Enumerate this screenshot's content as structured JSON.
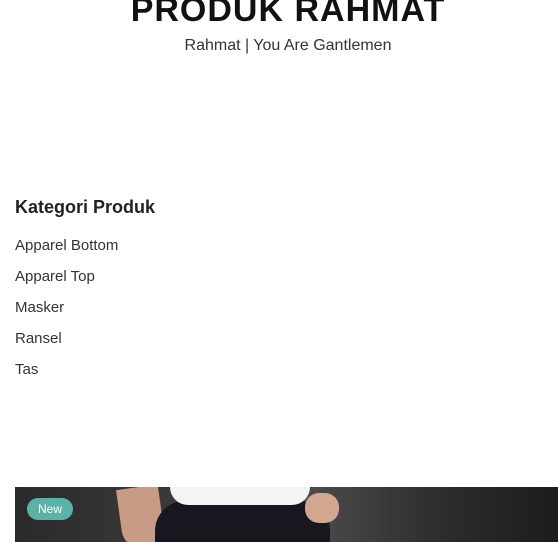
{
  "header": {
    "title": "PRODUK RAHMAT",
    "tagline": "Rahmat | You Are Gantlemen"
  },
  "sidebar": {
    "heading": "Kategori Produk",
    "categories": [
      {
        "label": "Apparel Bottom"
      },
      {
        "label": "Apparel Top"
      },
      {
        "label": "Masker"
      },
      {
        "label": "Ransel"
      },
      {
        "label": "Tas"
      }
    ]
  },
  "product": {
    "badge": "New"
  },
  "colors": {
    "badge_bg": "#5bb3a8",
    "title_text": "#111111",
    "body_text": "#333333"
  }
}
